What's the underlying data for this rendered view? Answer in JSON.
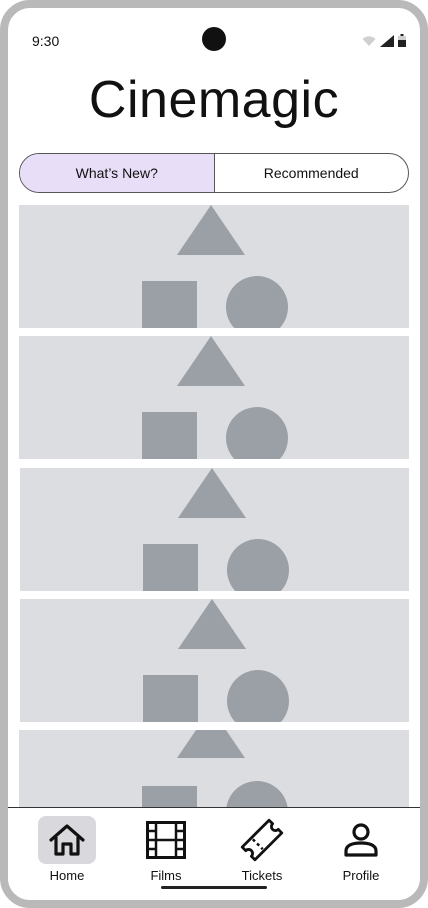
{
  "status_bar": {
    "time": "9:30"
  },
  "app": {
    "title": "Cinemagic"
  },
  "tabs": [
    {
      "label": "What’s New?",
      "active": true
    },
    {
      "label": "Recommended",
      "active": false
    }
  ],
  "cards": [
    {
      "image": "placeholder-image-icon"
    },
    {
      "image": "placeholder-image-icon"
    },
    {
      "image": "placeholder-image-icon"
    },
    {
      "image": "placeholder-image-icon"
    },
    {
      "image": "placeholder-image-icon"
    }
  ],
  "nav": {
    "items": [
      {
        "label": "Home",
        "icon": "home-icon",
        "active": true
      },
      {
        "label": "Films",
        "icon": "film-icon",
        "active": false
      },
      {
        "label": "Tickets",
        "icon": "ticket-icon",
        "active": false
      },
      {
        "label": "Profile",
        "icon": "profile-icon",
        "active": false
      }
    ]
  },
  "colors": {
    "active_tab": "#e8def8",
    "card_bg": "#dcdde0",
    "placeholder_shape": "#9aa0a6",
    "active_nav_bg": "#d9d9dd"
  }
}
